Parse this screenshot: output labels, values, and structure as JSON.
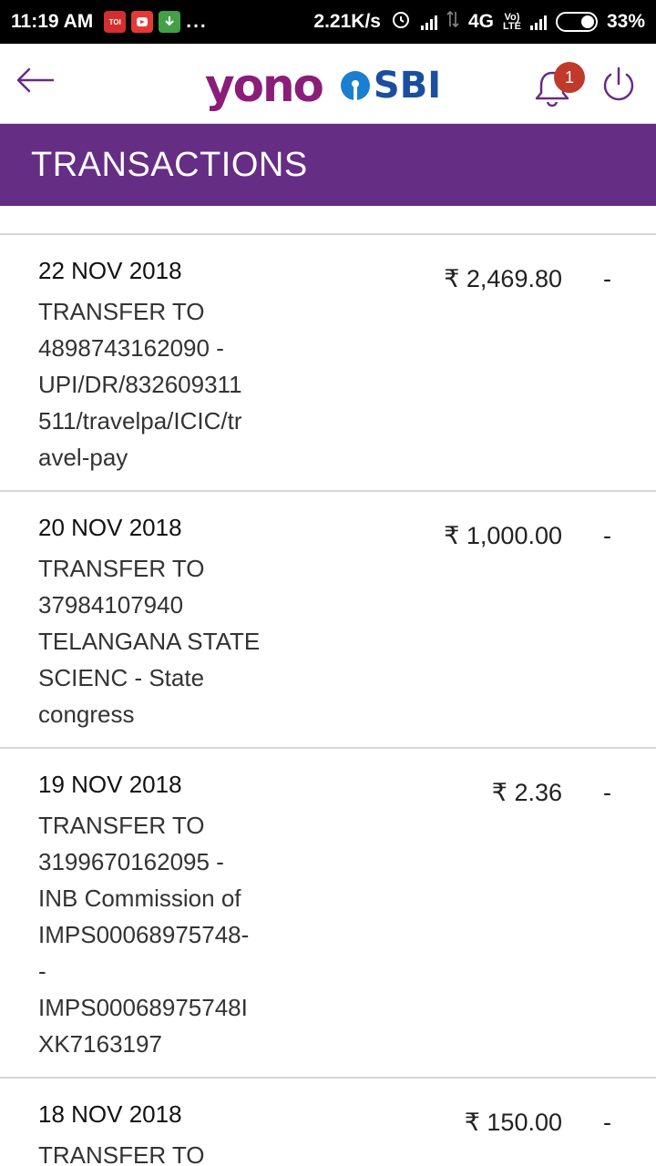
{
  "status_bar": {
    "time": "11:19 AM",
    "notif_toi": "TOI",
    "more": "...",
    "speed": "2.21K/s",
    "network": "4G",
    "lte_top": "Vo)",
    "lte_bottom": "LTE",
    "battery": "33%"
  },
  "header": {
    "logo_yono": "yono",
    "logo_sbi": "SBI",
    "notification_count": "1"
  },
  "page": {
    "title": "TRANSACTIONS"
  },
  "transactions": [
    {
      "date": "22 NOV 2018",
      "description": "TRANSFER TO 4898743162090 - UPI/DR/832609311511/travelpa/ICIC/travel-pay",
      "lines": [
        "TRANSFER TO",
        "4898743162090 -",
        "UPI/DR/832609311",
        "511/travelpa/ICIC/tr",
        "avel-pay"
      ],
      "amount": "₹ 2,469.80",
      "credit": "-"
    },
    {
      "date": "20 NOV 2018",
      "description": "TRANSFER TO 37984107940 TELANGANA STATE SCIENC - State congress",
      "lines": [
        "TRANSFER TO",
        "37984107940",
        "TELANGANA STATE",
        "SCIENC - State",
        "congress"
      ],
      "amount": "₹ 1,000.00",
      "credit": "-"
    },
    {
      "date": "19 NOV 2018",
      "description": "TRANSFER TO 3199670162095 - INB Commission of IMPS00068975748--IMPS00068975748IXK7163197",
      "lines": [
        "TRANSFER TO",
        "3199670162095 -",
        "INB Commission of",
        "IMPS00068975748-",
        "-",
        "IMPS00068975748I",
        "XK7163197"
      ],
      "amount": "₹ 2.36",
      "credit": "-"
    },
    {
      "date": "18 NOV 2018",
      "description": "TRANSFER TO",
      "lines": [
        "TRANSFER TO"
      ],
      "amount": "₹ 150.00",
      "credit": "-"
    }
  ]
}
